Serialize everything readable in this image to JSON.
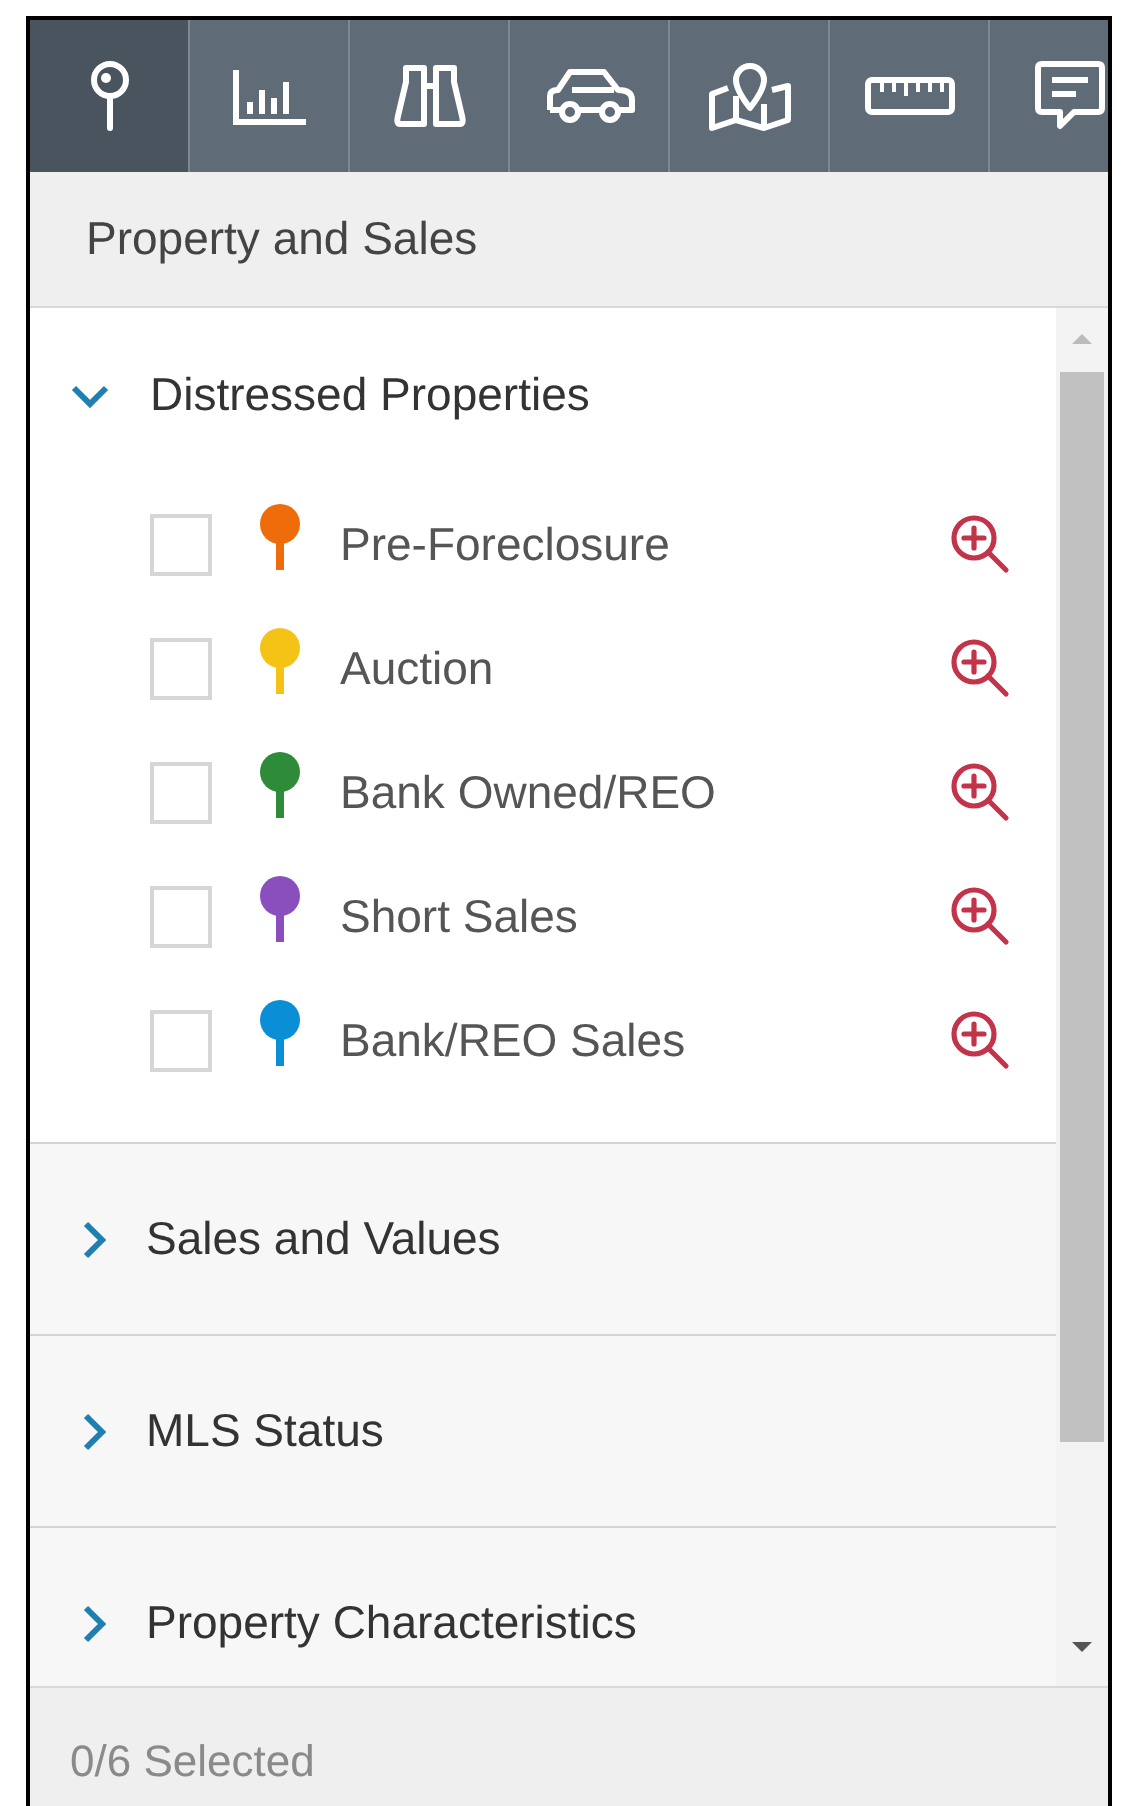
{
  "toolbar": {
    "tabs": [
      {
        "selected": true
      },
      {
        "selected": false
      },
      {
        "selected": false
      },
      {
        "selected": false
      },
      {
        "selected": false
      },
      {
        "selected": false
      },
      {
        "selected": false
      }
    ]
  },
  "panel_title": "Property and Sales",
  "sections": [
    {
      "title": "Distressed Properties",
      "expanded": true,
      "items": [
        {
          "label": "Pre-Foreclosure",
          "checked": false,
          "color": "#ee6c0a"
        },
        {
          "label": "Auction",
          "checked": false,
          "color": "#f5c216"
        },
        {
          "label": "Bank Owned/REO",
          "checked": false,
          "color": "#2e8b3a"
        },
        {
          "label": "Short Sales",
          "checked": false,
          "color": "#8a4fbd"
        },
        {
          "label": "Bank/REO Sales",
          "checked": false,
          "color": "#0a8fd6"
        }
      ]
    },
    {
      "title": "Sales and Values",
      "expanded": false
    },
    {
      "title": "MLS Status",
      "expanded": false
    },
    {
      "title": "Property Characteristics",
      "expanded": false
    }
  ],
  "footer": "0/6 Selected"
}
